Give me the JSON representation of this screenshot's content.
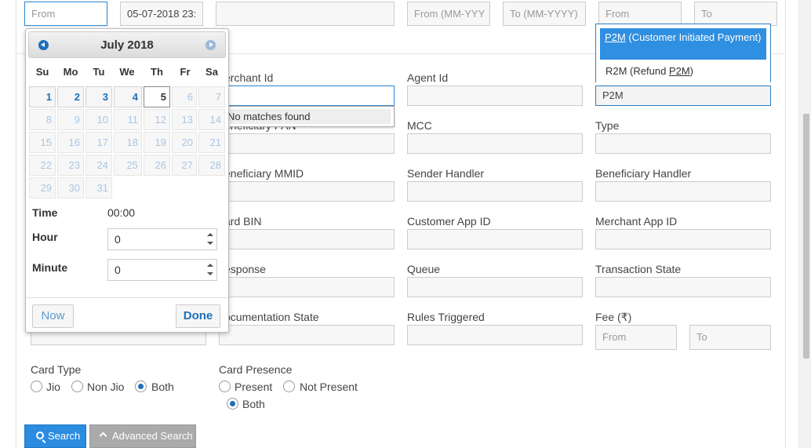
{
  "top_filters": {
    "from_placeholder": "From",
    "date_value": "05-07-2018 23:",
    "month_from_placeholder": "From (MM-YYY",
    "month_to_placeholder": "To (MM-YYYY)",
    "from2_placeholder": "From",
    "to2_placeholder": "To"
  },
  "datepicker": {
    "title": "July 2018",
    "weekdays": [
      "Su",
      "Mo",
      "Tu",
      "We",
      "Th",
      "Fr",
      "Sa"
    ],
    "days": [
      "1",
      "2",
      "3",
      "4",
      "5",
      "6",
      "7",
      "8",
      "9",
      "10",
      "11",
      "12",
      "13",
      "14",
      "15",
      "16",
      "17",
      "18",
      "19",
      "20",
      "21",
      "22",
      "23",
      "24",
      "25",
      "26",
      "27",
      "28",
      "29",
      "30",
      "31"
    ],
    "time_label": "Time",
    "time_value": "00:00",
    "hour_label": "Hour",
    "hour_value": "0",
    "minute_label": "Minute",
    "minute_value": "0",
    "now_label": "Now",
    "done_label": "Done"
  },
  "autocomplete": {
    "no_matches": "No matches found"
  },
  "p2m_dropdown": {
    "selected_code": "P2M",
    "selected_rest": " (Customer Initiated Payment)",
    "option2_prefix": "R2M (Refund ",
    "option2_code": "P2M",
    "option2_suffix": ")",
    "field_value": "P2M"
  },
  "labels": {
    "merchant_id": "erchant Id",
    "agent_id": "Agent Id",
    "beneficiary_pan": "eneficiary PAN",
    "mcc": "MCC",
    "type": "Type",
    "beneficiary_mmid": "eneficiary MMID",
    "sender_handler": "Sender Handler",
    "beneficiary_handler": "Beneficiary Handler",
    "card_bin": "ard BIN",
    "customer_app_id": "Customer App ID",
    "merchant_app_id": "Merchant App ID",
    "response": "esponse",
    "queue": "Queue",
    "transaction_state": "Transaction State",
    "documentation_state": "ocumentation State",
    "rules_triggered": "Rules Triggered",
    "fee": "Fee (₹)",
    "fee_from": "From",
    "fee_to": "To"
  },
  "card_type": {
    "label": "Card Type",
    "options": [
      "Jio",
      "Non Jio",
      "Both"
    ],
    "selected": "Both"
  },
  "card_presence": {
    "label": "Card Presence",
    "options": [
      "Present",
      "Not Present",
      "Both"
    ],
    "selected": "Both"
  },
  "buttons": {
    "search": "Search",
    "advanced_search": "Advanced Search"
  },
  "colors": {
    "accent": "#2b8ce0",
    "selected_option": "#2f8fe0",
    "secondary_button": "#aaaaaa"
  }
}
